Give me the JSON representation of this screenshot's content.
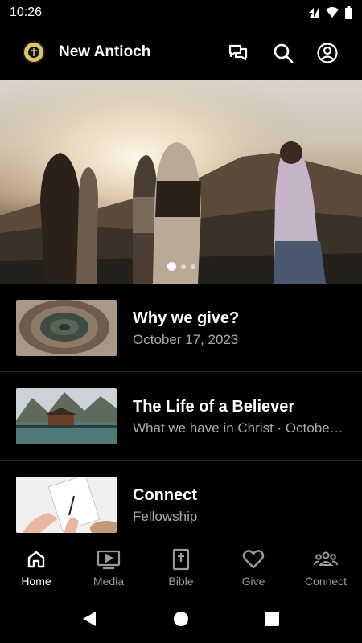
{
  "status_bar": {
    "time": "10:26"
  },
  "app_bar": {
    "title": "New Antioch"
  },
  "hero": {
    "slide_count": 3,
    "active_slide": 0
  },
  "feed": [
    {
      "title": "Why we give?",
      "subtitle": "October 17, 2023",
      "thumb": "wood-rings"
    },
    {
      "title": "The Life of a Believer",
      "subtitle": "What we have in Christ · October…",
      "thumb": "lake-house"
    },
    {
      "title": "Connect",
      "subtitle": "Fellowship",
      "thumb": "notebook-hands"
    }
  ],
  "bottom_nav": [
    {
      "label": "Home",
      "icon": "home-icon",
      "active": true
    },
    {
      "label": "Media",
      "icon": "media-icon",
      "active": false
    },
    {
      "label": "Bible",
      "icon": "bible-icon",
      "active": false
    },
    {
      "label": "Give",
      "icon": "heart-icon",
      "active": false
    },
    {
      "label": "Connect",
      "icon": "group-icon",
      "active": false
    }
  ],
  "colors": {
    "background": "#000000",
    "text_primary": "#ffffff",
    "text_secondary": "#a8a8a8",
    "nav_inactive": "#9a9a9a"
  }
}
